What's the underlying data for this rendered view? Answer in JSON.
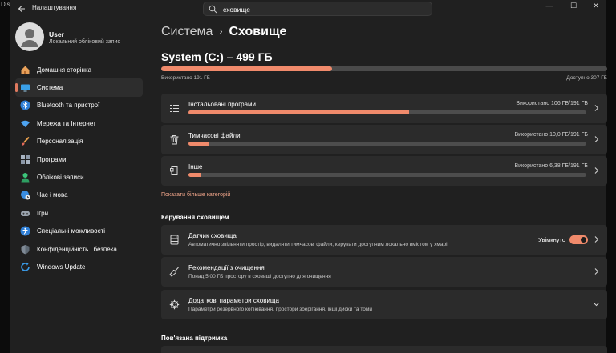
{
  "outer": {
    "left_label": "Dis"
  },
  "window": {
    "app_title": "Налаштування",
    "search": {
      "value": "сховище"
    },
    "controls": {
      "minimize": "—",
      "maximize": "☐",
      "close": "✕"
    }
  },
  "profile": {
    "name": "User",
    "subtitle": "Локальний обліковий запис"
  },
  "sidebar": {
    "items": [
      {
        "label": "Домашня сторінка",
        "icon": "home-icon",
        "active": false
      },
      {
        "label": "Система",
        "icon": "system-monitor-icon",
        "active": true
      },
      {
        "label": "Bluetooth та пристрої",
        "icon": "bluetooth-icon",
        "active": false
      },
      {
        "label": "Мережа та Інтернет",
        "icon": "wifi-icon",
        "active": false
      },
      {
        "label": "Персоналізація",
        "icon": "brush-icon",
        "active": false
      },
      {
        "label": "Програми",
        "icon": "apps-icon",
        "active": false
      },
      {
        "label": "Облікові записи",
        "icon": "accounts-icon",
        "active": false
      },
      {
        "label": "Час і мова",
        "icon": "globe-clock-icon",
        "active": false
      },
      {
        "label": "Ігри",
        "icon": "gamepad-icon",
        "active": false
      },
      {
        "label": "Спеціальні можливості",
        "icon": "accessibility-icon",
        "active": false
      },
      {
        "label": "Конфіденційність і безпека",
        "icon": "shield-icon",
        "active": false
      },
      {
        "label": "Windows Update",
        "icon": "windows-update-icon",
        "active": false
      }
    ]
  },
  "main": {
    "breadcrumb": {
      "parent": "Система",
      "separator": "›",
      "current": "Сховище"
    },
    "drive": {
      "title": "System (C:) – 499 ГБ",
      "used_fraction": 0.383,
      "used_label": "Використано 191 ГБ",
      "free_label": "Доступно 307 ГБ"
    },
    "categories": [
      {
        "title": "Інстальовані програми",
        "usage": "Використано 106 ГБ/191 ГБ",
        "fraction": 0.555,
        "icon": "installed-apps-icon"
      },
      {
        "title": "Тимчасові файли",
        "usage": "Використано 10,0 ГБ/191 ГБ",
        "fraction": 0.052,
        "icon": "trash-icon"
      },
      {
        "title": "Інше",
        "usage": "Використано 6,38 ГБ/191 ГБ",
        "fraction": 0.033,
        "icon": "other-files-icon"
      }
    ],
    "show_more": "Показати більше категорій",
    "management": {
      "title": "Керування сховищем",
      "items": [
        {
          "title": "Датчик сховища",
          "subtitle": "Автоматично звільняти простір, видаляти тимчасові файли, керувати доступним локально вмістом у хмарі",
          "icon": "storage-sense-icon",
          "toggle_label": "Увімкнуто",
          "toggle_on": true
        },
        {
          "title": "Рекомендації з очищення",
          "subtitle": "Понад 5,00 ГБ простору в сховищі доступно для очищення",
          "icon": "cleanup-brush-icon"
        },
        {
          "title": "Додаткові параметри сховища",
          "subtitle": "Параметри резервного копіювання, простори зберігання, інші диски та томи",
          "icon": "gear-icon"
        }
      ]
    },
    "related": {
      "title": "Пов'язана підтримка"
    }
  },
  "colors": {
    "accent": "#f08a6b",
    "background": "#202020",
    "card": "#2b2b2b",
    "track": "#4d4d4d"
  }
}
